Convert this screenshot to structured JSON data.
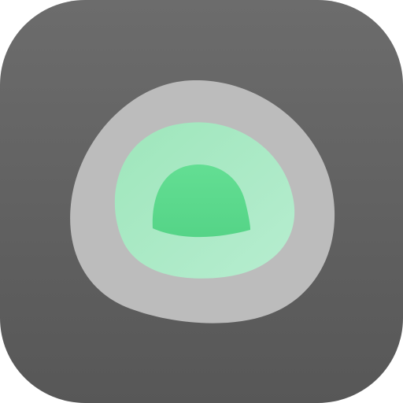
{
  "app_icon": {
    "name": "concentric-blob-icon",
    "colors": {
      "tile_top": "#6a6a6a",
      "tile_bottom": "#595959",
      "outer_ring": "#bdbdbd",
      "middle_ring": "#a9e9c4",
      "inner_core": "#5fdc8f"
    }
  }
}
